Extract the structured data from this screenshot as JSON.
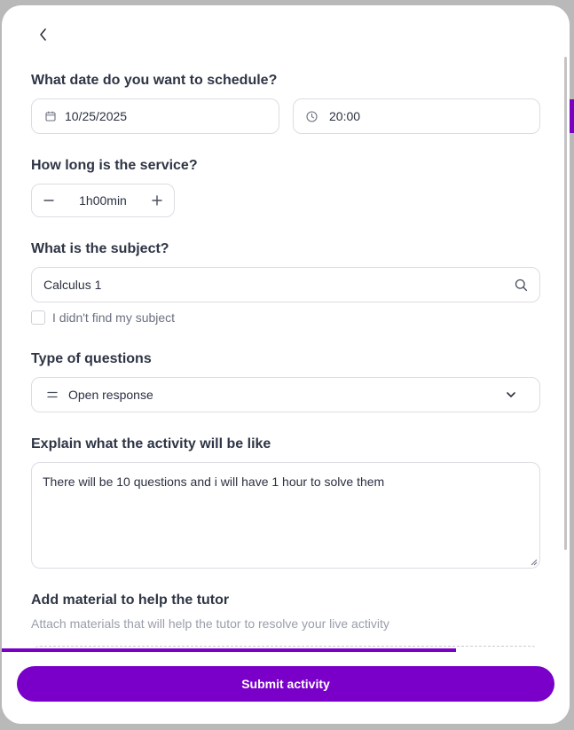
{
  "back": {
    "icon": "chevron-left-icon"
  },
  "schedule": {
    "question": "What date do you want to schedule?",
    "date_value": "10/25/2025",
    "date_icon": "calendar-icon",
    "time_value": "20:00",
    "time_icon": "clock-icon"
  },
  "duration": {
    "question": "How long is the service?",
    "value": "1h00min",
    "decrement_icon": "minus-icon",
    "increment_icon": "plus-icon"
  },
  "subject": {
    "question": "What is the subject?",
    "value": "Calculus 1",
    "search_icon": "search-icon",
    "not_found_label": "I didn't find my subject"
  },
  "question_type": {
    "question": "Type of questions",
    "value": "Open response",
    "icon": "equals-icon",
    "dropdown_icon": "chevron-down-icon"
  },
  "activity": {
    "question": "Explain what the activity will be like",
    "value": "There will be 10 questions and i will have 1 hour to solve them"
  },
  "material": {
    "question": "Add material to help the tutor",
    "subtitle": "Attach materials that will help the tutor to resolve your live activity"
  },
  "progress": {
    "fraction": 0.8
  },
  "submit": {
    "label": "Submit activity"
  },
  "colors": {
    "accent": "#7a00c9",
    "border": "#dcdde3",
    "muted": "#9a9eab"
  }
}
